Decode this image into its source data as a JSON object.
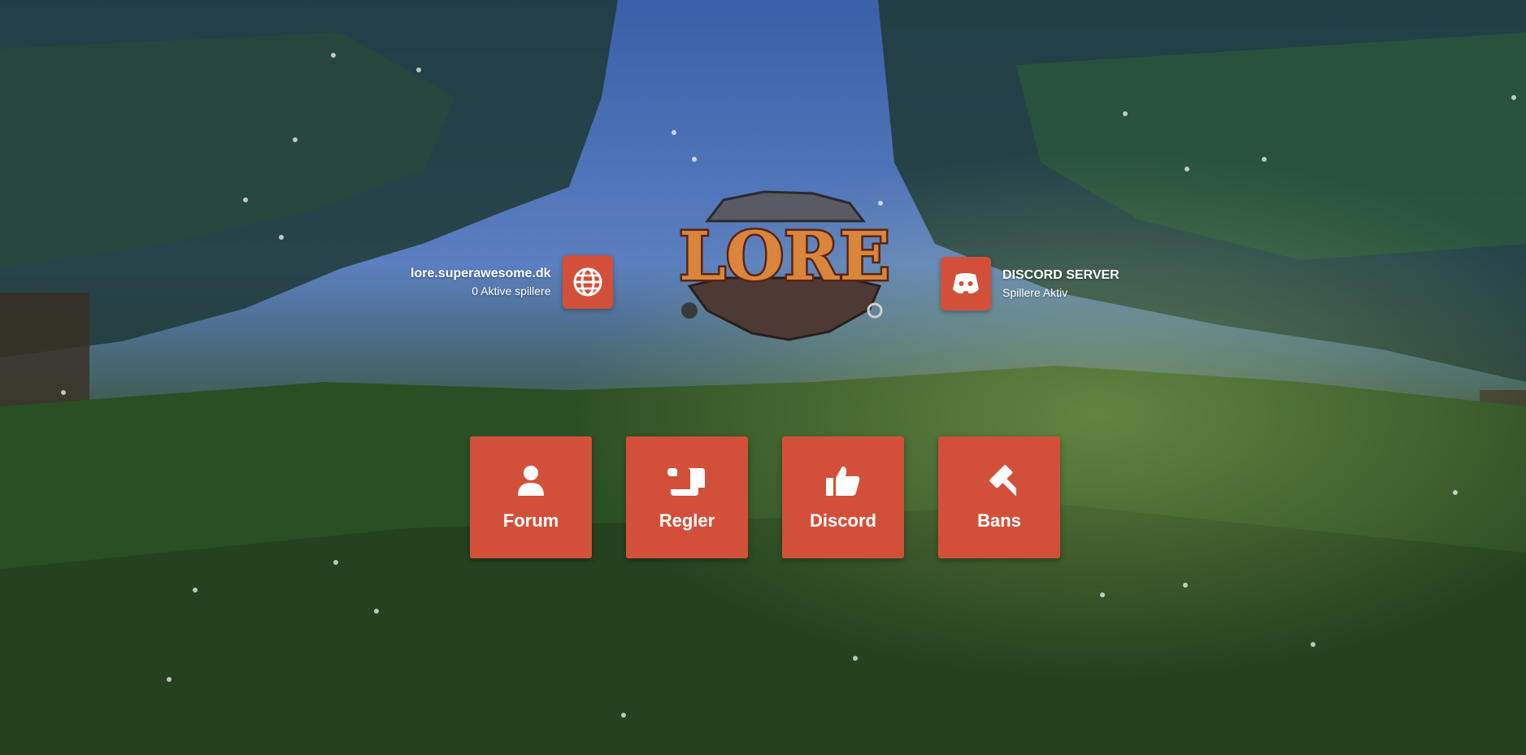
{
  "background": {
    "sky_color": "#4a6fb5",
    "foliage_color": "#2c5a2a"
  },
  "server": {
    "address": "lore.superawesome.dk",
    "active_players": "0 Aktive spillere",
    "icon": "globe-icon"
  },
  "discord": {
    "title": "DISCORD SERVER",
    "subtitle": "Spillere Aktiv",
    "icon": "discord-icon"
  },
  "logo": {
    "text": "LORE"
  },
  "tiles": [
    {
      "label": "Forum",
      "icon": "user-icon"
    },
    {
      "label": "Regler",
      "icon": "scroll-icon"
    },
    {
      "label": "Discord",
      "icon": "thumbs-up-icon"
    },
    {
      "label": "Bans",
      "icon": "gavel-icon"
    }
  ],
  "colors": {
    "accent": "#d2503a",
    "text": "#ffffff"
  }
}
